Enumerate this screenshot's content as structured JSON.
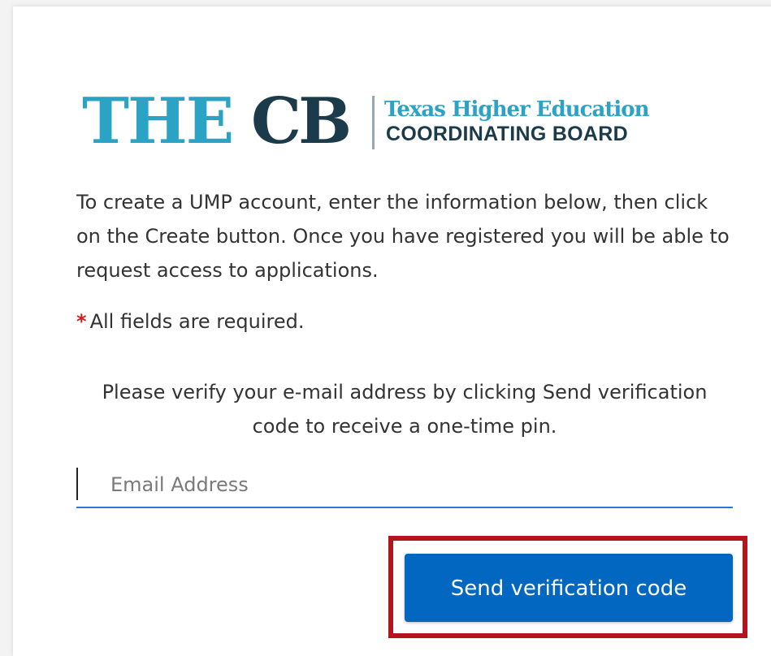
{
  "logo": {
    "acronym_part1": "THE",
    "acronym_part2": "CB",
    "line1": "Texas Higher Education",
    "line2": "COORDINATING BOARD",
    "colors": {
      "teal": "#2aa3c4",
      "navy": "#1c3b4a"
    }
  },
  "intro_text": "To create a UMP account, enter the information below, then click on the Create button. Once you have registered you will be able to request access to applications.",
  "required_note": {
    "asterisk": "*",
    "text": "All fields are required."
  },
  "verify_text": "Please verify your e-mail address by clicking Send verification code to receive a one-time pin.",
  "email": {
    "placeholder": "Email Address",
    "value": ""
  },
  "send_button_label": "Send verification code",
  "colors": {
    "button": "#0167c0",
    "highlight": "#b4141e",
    "input_underline": "#2b78d8",
    "asterisk": "#d11d1d"
  }
}
